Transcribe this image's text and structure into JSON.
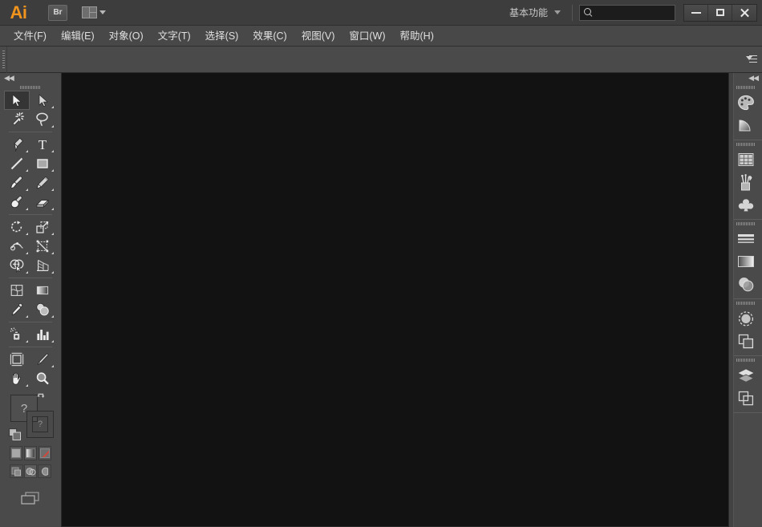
{
  "app": {
    "logo": "Ai",
    "bridge_button": "Br",
    "workspace": "基本功能",
    "search_value": "",
    "search_placeholder": ""
  },
  "window_controls": [
    {
      "name": "minimize-button",
      "label": "—"
    },
    {
      "name": "maximize-button",
      "label": "□"
    },
    {
      "name": "close-button",
      "label": "✕"
    }
  ],
  "menubar": {
    "items": [
      {
        "label": "文件(F)",
        "name": "menu-file"
      },
      {
        "label": "编辑(E)",
        "name": "menu-edit"
      },
      {
        "label": "对象(O)",
        "name": "menu-object"
      },
      {
        "label": "文字(T)",
        "name": "menu-type"
      },
      {
        "label": "选择(S)",
        "name": "menu-select"
      },
      {
        "label": "效果(C)",
        "name": "menu-effect"
      },
      {
        "label": "视图(V)",
        "name": "menu-view"
      },
      {
        "label": "窗口(W)",
        "name": "menu-window"
      },
      {
        "label": "帮助(H)",
        "name": "menu-help"
      }
    ]
  },
  "control_bar": {
    "content": "",
    "panel_menu_icon": "panel-menu-icon"
  },
  "toolbar": {
    "collapse_label": "◀◀",
    "tools": [
      {
        "row": 1,
        "left": "selection-tool",
        "right": "direct-selection-tool"
      },
      {
        "row": 2,
        "left": "magic-wand-tool",
        "right": "lasso-tool"
      },
      {
        "row": 3,
        "left": "pen-tool",
        "right": "type-tool"
      },
      {
        "row": 4,
        "left": "line-segment-tool",
        "right": "rectangle-tool"
      },
      {
        "row": 5,
        "left": "paintbrush-tool",
        "right": "pencil-tool"
      },
      {
        "row": 6,
        "left": "blob-brush-tool",
        "right": "eraser-tool"
      },
      {
        "row": 7,
        "left": "rotate-tool",
        "right": "scale-tool"
      },
      {
        "row": 8,
        "left": "width-tool",
        "right": "free-transform-tool"
      },
      {
        "row": 9,
        "left": "shape-builder-tool",
        "right": "perspective-grid-tool"
      },
      {
        "row": 10,
        "left": "mesh-tool",
        "right": "gradient-tool"
      },
      {
        "row": 11,
        "left": "eyedropper-tool",
        "right": "blend-tool"
      },
      {
        "row": 12,
        "left": "symbol-sprayer-tool",
        "right": "column-graph-tool"
      },
      {
        "row": 13,
        "left": "artboard-tool",
        "right": "slice-tool"
      },
      {
        "row": 14,
        "left": "hand-tool",
        "right": "zoom-tool"
      }
    ],
    "selected_tool": "selection-tool",
    "fill_label": "?",
    "stroke_label": "?",
    "fill_hint_1": "?",
    "fill_hint_2": "?",
    "color_mode_buttons": [
      {
        "name": "fill-color-button",
        "type": "color"
      },
      {
        "name": "gradient-button",
        "type": "gradient"
      },
      {
        "name": "none-button",
        "type": "none"
      }
    ],
    "draw_modes": [
      {
        "name": "draw-normal-button"
      },
      {
        "name": "draw-behind-button"
      },
      {
        "name": "draw-inside-button"
      }
    ],
    "screen_mode": "change-screen-mode-button"
  },
  "dock": {
    "collapse_label": "◀◀",
    "groups": [
      {
        "name": "dock-group-color",
        "items": [
          {
            "name": "color-panel-icon"
          },
          {
            "name": "color-guide-panel-icon"
          }
        ]
      },
      {
        "name": "dock-group-assets",
        "items": [
          {
            "name": "swatches-panel-icon"
          },
          {
            "name": "brushes-panel-icon"
          },
          {
            "name": "symbols-panel-icon"
          }
        ]
      },
      {
        "name": "dock-group-appearance",
        "items": [
          {
            "name": "stroke-panel-icon"
          },
          {
            "name": "gradient-panel-icon"
          },
          {
            "name": "transparency-panel-icon"
          }
        ]
      },
      {
        "name": "dock-group-effects",
        "items": [
          {
            "name": "appearance-panel-icon"
          },
          {
            "name": "graphic-styles-panel-icon"
          }
        ]
      },
      {
        "name": "dock-group-layers",
        "items": [
          {
            "name": "layers-panel-icon"
          },
          {
            "name": "artboards-panel-icon"
          }
        ]
      }
    ]
  },
  "canvas": {
    "background_color": "#121212",
    "content": ""
  },
  "colors": {
    "accent": "#f0941e",
    "chrome": "#4a4a4a",
    "titlebar": "#3d3d3d",
    "menubar": "#484848",
    "canvas": "#121212",
    "text": "#e0e0e0"
  }
}
